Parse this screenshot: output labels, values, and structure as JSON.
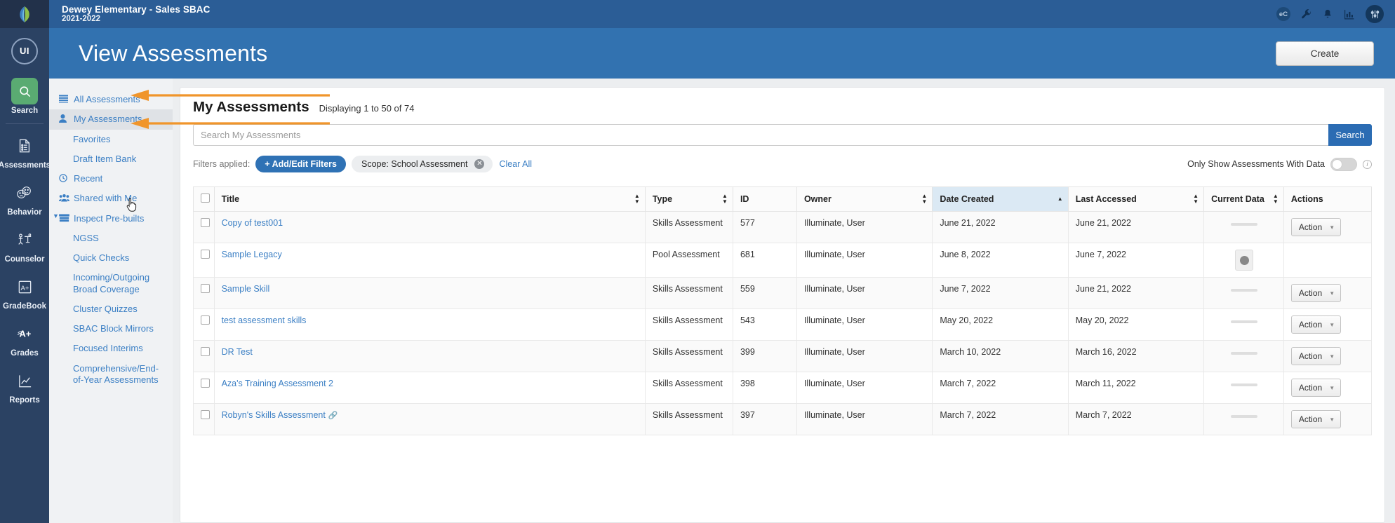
{
  "topbar": {
    "org_name": "Dewey Elementary - Sales SBAC",
    "org_year": "2021-2022",
    "icons": [
      {
        "name": "ec-badge-icon",
        "label": "eC"
      },
      {
        "name": "wrench-icon",
        "label": ""
      },
      {
        "name": "bell-icon",
        "label": ""
      },
      {
        "name": "bar-chart-icon",
        "label": ""
      },
      {
        "name": "sliders-icon",
        "label": ""
      }
    ]
  },
  "banner": {
    "title": "View Assessments",
    "create_label": "Create"
  },
  "rail": {
    "avatar_initials": "UI",
    "items": [
      {
        "label": "Search",
        "icon": "search-icon",
        "active": true
      },
      {
        "label": "Assessments",
        "icon": "document-list-icon",
        "active": false
      },
      {
        "label": "Behavior",
        "icon": "faces-icon",
        "active": false
      },
      {
        "label": "Counselor",
        "icon": "counselor-icon",
        "active": false
      },
      {
        "label": "GradeBook",
        "icon": "gradebook-a-plus-icon",
        "active": false
      },
      {
        "label": "Grades",
        "icon": "grades-a-plus-icon",
        "active": false
      },
      {
        "label": "Reports",
        "icon": "reports-chart-icon",
        "active": false
      }
    ]
  },
  "subnav": {
    "items": [
      {
        "label": "All Assessments",
        "icon": "list-icon",
        "level": 0,
        "selected": false,
        "caret": false
      },
      {
        "label": "My Assessments",
        "icon": "user-icon",
        "level": 0,
        "selected": true,
        "caret": false
      },
      {
        "label": "Favorites",
        "icon": "",
        "level": 1,
        "selected": false,
        "caret": false
      },
      {
        "label": "Draft Item Bank",
        "icon": "",
        "level": 1,
        "selected": false,
        "caret": false
      },
      {
        "label": "Recent",
        "icon": "clock-icon",
        "level": 0,
        "selected": false,
        "caret": false
      },
      {
        "label": "Shared with Me",
        "icon": "users-icon",
        "level": 0,
        "selected": false,
        "caret": false
      },
      {
        "label": "Inspect Pre-builts",
        "icon": "bank-icon",
        "level": 0,
        "selected": false,
        "caret": true
      },
      {
        "label": "NGSS",
        "icon": "",
        "level": 1,
        "selected": false,
        "caret": false
      },
      {
        "label": "Quick Checks",
        "icon": "",
        "level": 1,
        "selected": false,
        "caret": false
      },
      {
        "label": "Incoming/Outgoing Broad Coverage",
        "icon": "",
        "level": 1,
        "selected": false,
        "caret": false
      },
      {
        "label": "Cluster Quizzes",
        "icon": "",
        "level": 1,
        "selected": false,
        "caret": false
      },
      {
        "label": "SBAC Block Mirrors",
        "icon": "",
        "level": 1,
        "selected": false,
        "caret": false
      },
      {
        "label": "Focused Interims",
        "icon": "",
        "level": 1,
        "selected": false,
        "caret": false
      },
      {
        "label": "Comprehensive/End-of-Year Assessments",
        "icon": "",
        "level": 1,
        "selected": false,
        "caret": false
      }
    ]
  },
  "main": {
    "heading": "My Assessments",
    "displaying": "Displaying 1 to 50 of 74",
    "search": {
      "placeholder": "Search My Assessments",
      "value": "",
      "button_label": "Search"
    },
    "filters": {
      "label": "Filters applied:",
      "add_edit_label": "+ Add/Edit Filters",
      "chip_label": "Scope: School Assessment",
      "chip_remove_icon": "close-circle-icon",
      "clear_all_label": "Clear All"
    },
    "data_toggle": {
      "label": "Only Show Assessments With Data",
      "state": "off",
      "info_icon": "info-icon"
    },
    "table": {
      "columns": [
        {
          "key": "checkbox",
          "label": "",
          "sortable": false,
          "sorted": "none"
        },
        {
          "key": "title",
          "label": "Title",
          "sortable": true,
          "sorted": "none"
        },
        {
          "key": "type",
          "label": "Type",
          "sortable": true,
          "sorted": "none"
        },
        {
          "key": "id",
          "label": "ID",
          "sortable": false,
          "sorted": "none"
        },
        {
          "key": "owner",
          "label": "Owner",
          "sortable": true,
          "sorted": "none"
        },
        {
          "key": "date_created",
          "label": "Date Created",
          "sortable": true,
          "sorted": "asc"
        },
        {
          "key": "last_accessed",
          "label": "Last Accessed",
          "sortable": true,
          "sorted": "none"
        },
        {
          "key": "current_data",
          "label": "Current Data",
          "sortable": true,
          "sorted": "none"
        },
        {
          "key": "actions",
          "label": "Actions",
          "sortable": false,
          "sorted": "none"
        }
      ],
      "rows": [
        {
          "title": "Copy of test001",
          "external": false,
          "type": "Skills Assessment",
          "id": "577",
          "owner": "Illuminate, User",
          "date_created": "June 21, 2022",
          "last_accessed": "June 21, 2022",
          "current_data": "none",
          "action_label": "Action",
          "has_action": true
        },
        {
          "title": "Sample Legacy",
          "external": false,
          "type": "Pool Assessment",
          "id": "681",
          "owner": "Illuminate, User",
          "date_created": "June 8, 2022",
          "last_accessed": "June 7, 2022",
          "current_data": "dot",
          "action_label": "",
          "has_action": false
        },
        {
          "title": "Sample Skill",
          "external": false,
          "type": "Skills Assessment",
          "id": "559",
          "owner": "Illuminate, User",
          "date_created": "June 7, 2022",
          "last_accessed": "June 21, 2022",
          "current_data": "none",
          "action_label": "Action",
          "has_action": true
        },
        {
          "title": "test assessment skills",
          "external": false,
          "type": "Skills Assessment",
          "id": "543",
          "owner": "Illuminate, User",
          "date_created": "May 20, 2022",
          "last_accessed": "May 20, 2022",
          "current_data": "none",
          "action_label": "Action",
          "has_action": true
        },
        {
          "title": "DR Test",
          "external": false,
          "type": "Skills Assessment",
          "id": "399",
          "owner": "Illuminate, User",
          "date_created": "March 10, 2022",
          "last_accessed": "March 16, 2022",
          "current_data": "none",
          "action_label": "Action",
          "has_action": true
        },
        {
          "title": "Aza's Training Assessment 2",
          "external": false,
          "type": "Skills Assessment",
          "id": "398",
          "owner": "Illuminate, User",
          "date_created": "March 7, 2022",
          "last_accessed": "March 11, 2022",
          "current_data": "none",
          "action_label": "Action",
          "has_action": true
        },
        {
          "title": "Robyn's Skills Assessment",
          "external": true,
          "type": "Skills Assessment",
          "id": "397",
          "owner": "Illuminate, User",
          "date_created": "March 7, 2022",
          "last_accessed": "March 7, 2022",
          "current_data": "none",
          "action_label": "Action",
          "has_action": true
        }
      ]
    }
  },
  "annotations": {
    "arrow_color": "#f0952b",
    "arrows": [
      {
        "name": "arrow-to-all-assessments"
      },
      {
        "name": "arrow-to-my-assessments"
      }
    ]
  }
}
